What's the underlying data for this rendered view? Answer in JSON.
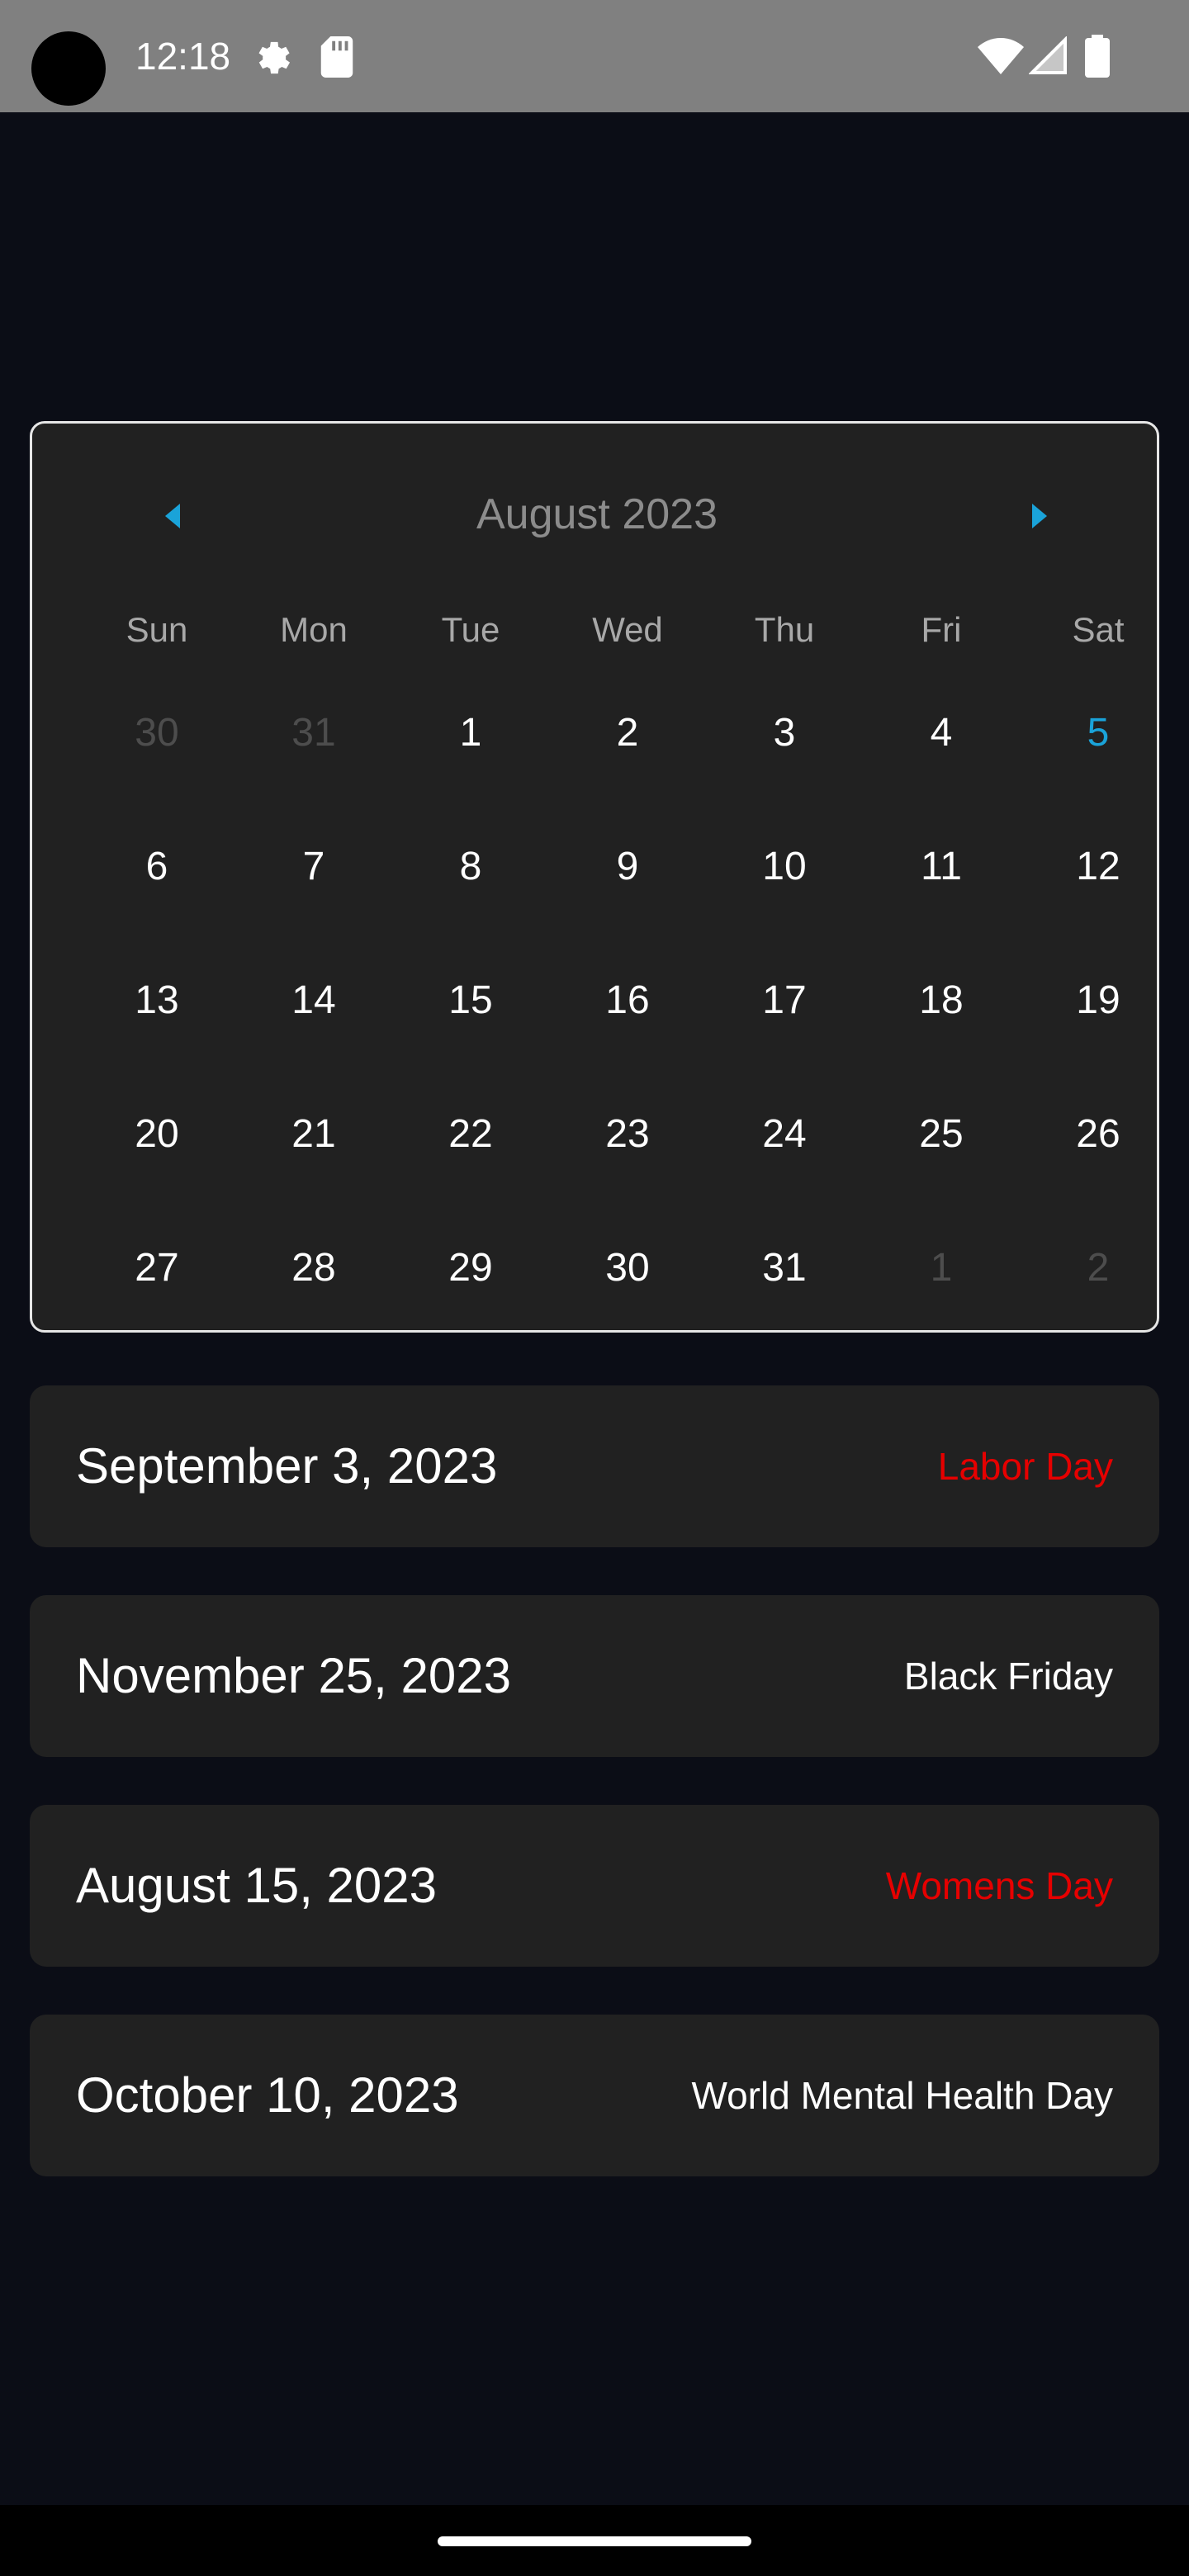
{
  "status_bar": {
    "time": "12:18",
    "icons": [
      "camera-hole",
      "gear-icon",
      "sd-card-icon",
      "wifi-icon",
      "signal-icon",
      "battery-icon"
    ]
  },
  "calendar": {
    "month_label": "August 2023",
    "prev_icon": "chevron-left-icon",
    "next_icon": "chevron-right-icon",
    "accent_color": "#1aa3d9",
    "weekdays": [
      "Sun",
      "Mon",
      "Tue",
      "Wed",
      "Thu",
      "Fri",
      "Sat"
    ],
    "weeks": [
      [
        {
          "d": "30",
          "m": true
        },
        {
          "d": "31",
          "m": true
        },
        {
          "d": "1"
        },
        {
          "d": "2"
        },
        {
          "d": "3"
        },
        {
          "d": "4"
        },
        {
          "d": "5",
          "t": true
        }
      ],
      [
        {
          "d": "6"
        },
        {
          "d": "7"
        },
        {
          "d": "8"
        },
        {
          "d": "9"
        },
        {
          "d": "10"
        },
        {
          "d": "11"
        },
        {
          "d": "12"
        }
      ],
      [
        {
          "d": "13"
        },
        {
          "d": "14"
        },
        {
          "d": "15"
        },
        {
          "d": "16"
        },
        {
          "d": "17"
        },
        {
          "d": "18"
        },
        {
          "d": "19"
        }
      ],
      [
        {
          "d": "20"
        },
        {
          "d": "21"
        },
        {
          "d": "22"
        },
        {
          "d": "23"
        },
        {
          "d": "24"
        },
        {
          "d": "25"
        },
        {
          "d": "26"
        }
      ],
      [
        {
          "d": "27"
        },
        {
          "d": "28"
        },
        {
          "d": "29"
        },
        {
          "d": "30"
        },
        {
          "d": "31"
        },
        {
          "d": "1",
          "m": true
        },
        {
          "d": "2",
          "m": true
        }
      ]
    ]
  },
  "holidays": [
    {
      "date": "September 3, 2023",
      "name": "Labor Day",
      "red": true
    },
    {
      "date": "November 25, 2023",
      "name": "Black Friday",
      "red": false
    },
    {
      "date": "August 15, 2023",
      "name": "Womens Day",
      "red": true
    },
    {
      "date": "October 10, 2023",
      "name": "World Mental Health Day",
      "red": false
    }
  ],
  "colors": {
    "background": "#0b0d16",
    "card": "#212121",
    "holiday_red": "#e60000"
  }
}
